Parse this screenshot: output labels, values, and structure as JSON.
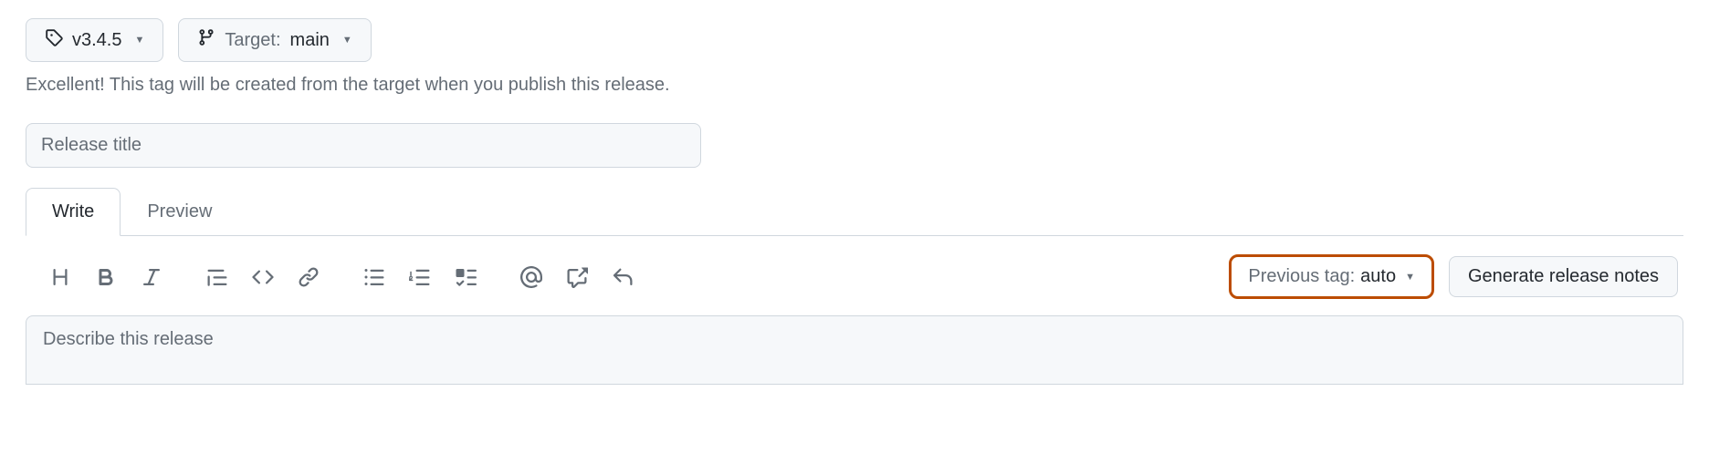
{
  "tag_selector": {
    "value": "v3.4.5"
  },
  "target_selector": {
    "label": "Target:",
    "value": "main"
  },
  "helper_text": "Excellent! This tag will be created from the target when you publish this release.",
  "release_title": {
    "placeholder": "Release title",
    "value": ""
  },
  "tabs": {
    "write": "Write",
    "preview": "Preview"
  },
  "prev_tag": {
    "label": "Previous tag:",
    "value": "auto"
  },
  "generate_button": "Generate release notes",
  "description": {
    "placeholder": "Describe this release",
    "value": ""
  }
}
